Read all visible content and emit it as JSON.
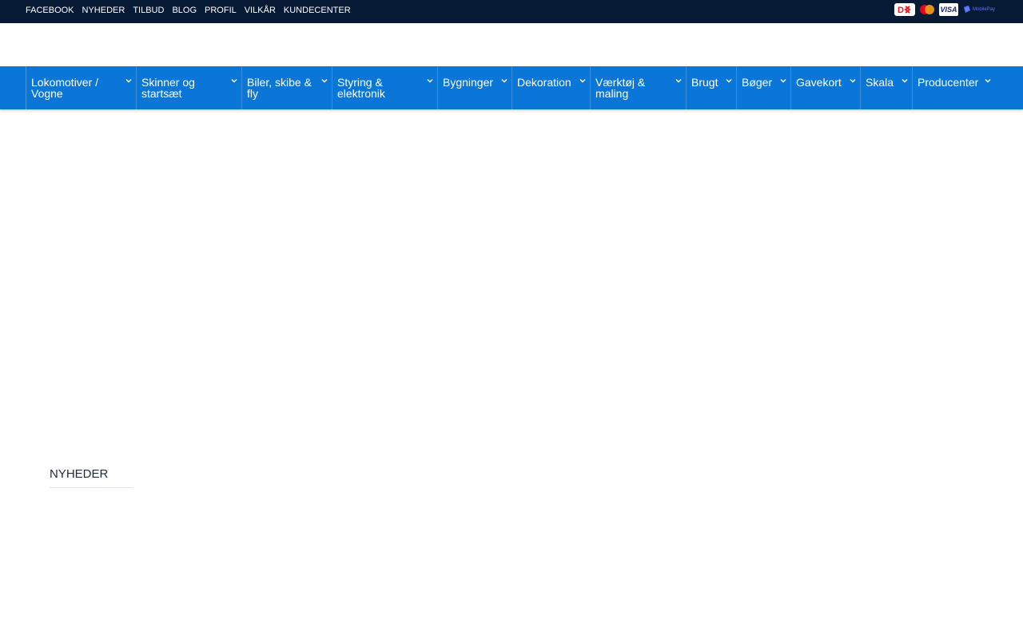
{
  "topbar": {
    "links": [
      "FACEBOOK",
      "NYHEDER",
      "TILBUD",
      "BLOG",
      "PROFIL",
      "VILKÅR",
      "KUNDECENTER"
    ],
    "payment_icons": [
      "dankort-icon",
      "mastercard-icon",
      "visa-icon",
      "mobilepay-icon"
    ],
    "visa_text": "VISA",
    "mobilepay_text": "MobilePay"
  },
  "nav": {
    "items": [
      {
        "label": "Lokomotiver / Vogne"
      },
      {
        "label": "Skinner og startsæt"
      },
      {
        "label": "Biler, skibe & fly"
      },
      {
        "label": "Styring & elektronik"
      },
      {
        "label": "Bygninger"
      },
      {
        "label": "Dekoration"
      },
      {
        "label": "Værktøj & maling"
      },
      {
        "label": "Brugt"
      },
      {
        "label": "Bøger"
      },
      {
        "label": "Gavekort"
      },
      {
        "label": "Skala"
      },
      {
        "label": "Producenter"
      }
    ]
  },
  "main": {
    "news_heading": "NYHEDER"
  },
  "colors": {
    "topbar_bg": "#071a35",
    "nav_bg": "#0a77d8"
  }
}
